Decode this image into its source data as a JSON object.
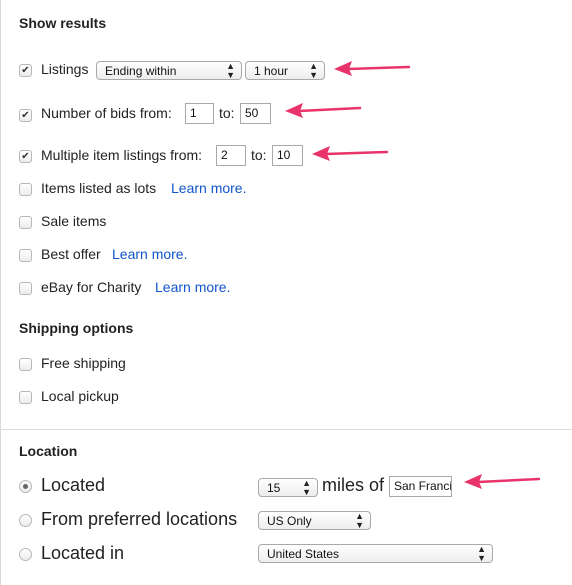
{
  "show_results": {
    "heading": "Show results",
    "listings": {
      "label": "Listings",
      "checked": true,
      "ending_select": "Ending within",
      "time_select": "1 hour"
    },
    "bids": {
      "label": "Number of bids from:",
      "checked": true,
      "from": "1",
      "to_label": "to:",
      "to": "50"
    },
    "multiple": {
      "label": "Multiple item listings from:",
      "checked": true,
      "from": "2",
      "to_label": "to:",
      "to": "10"
    },
    "lots": {
      "label": "Items listed as lots",
      "link": "Learn more.",
      "checked": false
    },
    "sale": {
      "label": "Sale items",
      "checked": false
    },
    "best_offer": {
      "label": "Best offer",
      "link": "Learn more.",
      "checked": false
    },
    "charity": {
      "label": "eBay for Charity",
      "link": "Learn more.",
      "checked": false
    }
  },
  "shipping": {
    "heading": "Shipping options",
    "free": {
      "label": "Free shipping",
      "checked": false
    },
    "local": {
      "label": "Local pickup",
      "checked": false
    }
  },
  "location": {
    "heading": "Location",
    "located": {
      "label": "Located",
      "selected": true,
      "miles_select": "15",
      "miles_label": "miles of",
      "place": "San Francisco"
    },
    "preferred": {
      "label": "From preferred locations",
      "selected": false,
      "select": "US Only"
    },
    "located_in": {
      "label": "Located in",
      "selected": false,
      "select": "United States"
    }
  },
  "colors": {
    "arrow": "#e8336b",
    "link": "#1155cc"
  },
  "icons": {
    "checkbox_check": "check-icon",
    "select_arrows": "up-down-arrows-icon",
    "annotation": "arrow-left-icon"
  }
}
